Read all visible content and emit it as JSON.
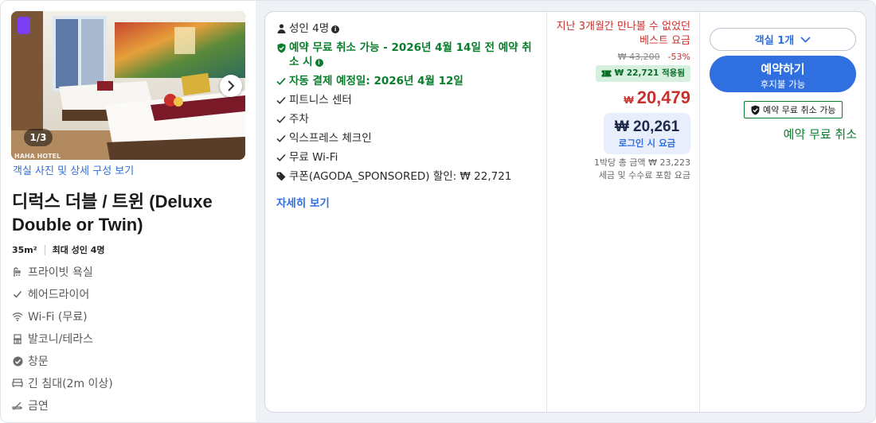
{
  "gallery": {
    "counter": "1/3",
    "watermark": "HAHA HOTEL",
    "photos_link": "객실 사진 및 상세 구성 보기"
  },
  "room": {
    "title": "디럭스 더블 / 트윈 (Deluxe Double or Twin)",
    "size": "35m²",
    "occupancy": "최대 성인 4명",
    "amenities": [
      {
        "icon": "shower-icon",
        "label": "프라이빗 욕실"
      },
      {
        "icon": "check-icon",
        "label": "헤어드라이어"
      },
      {
        "icon": "wifi-icon",
        "label": "Wi-Fi (무료)"
      },
      {
        "icon": "balcony-icon",
        "label": "발코니/테라스"
      },
      {
        "icon": "window-check-icon",
        "label": "창문"
      },
      {
        "icon": "bed-icon",
        "label": "긴 침대(2m 이상)"
      },
      {
        "icon": "no-smoking-icon",
        "label": "금연"
      }
    ]
  },
  "benefits": {
    "guests": "성인 4명",
    "free_cancel": "예약 무료 취소 가능 - 2026년 4월 14일 전 예약 취소 시",
    "auto_pay": "자동 결제 예정일: 2026년 4월 12일",
    "items": [
      "피트니스 센터",
      "주차",
      "익스프레스 체크인",
      "무료 Wi-Fi"
    ],
    "coupon": "쿠폰(AGODA_SPONSORED) 할인: ₩ 22,721",
    "more_link": "자세히 보기"
  },
  "pricing": {
    "best_price_note": "지난 3개월간 만나볼 수 없었던 베스트 요금",
    "original_price": "₩ 43,200",
    "discount_pct": "-53%",
    "coupon_applied": "₩ 22,721 적용됨",
    "currency": "₩",
    "price": "20,479",
    "login_price": "₩ 20,261",
    "login_label": "로그인 시 요금",
    "total_line": "1박당 총 금액 ₩ 23,223",
    "tax_line": "세금 및 수수료 포함 요금"
  },
  "booking": {
    "room_count": "객실 1개",
    "book_label": "예약하기",
    "book_sub": "후지불 가능",
    "free_badge": "예약 무료 취소 가능",
    "free_text": "예약 무료 취소"
  },
  "colors": {
    "accent_blue": "#2f6fe0",
    "price_red": "#c9302c",
    "green": "#0a7d2c",
    "coupon_bg": "#d7efde"
  }
}
